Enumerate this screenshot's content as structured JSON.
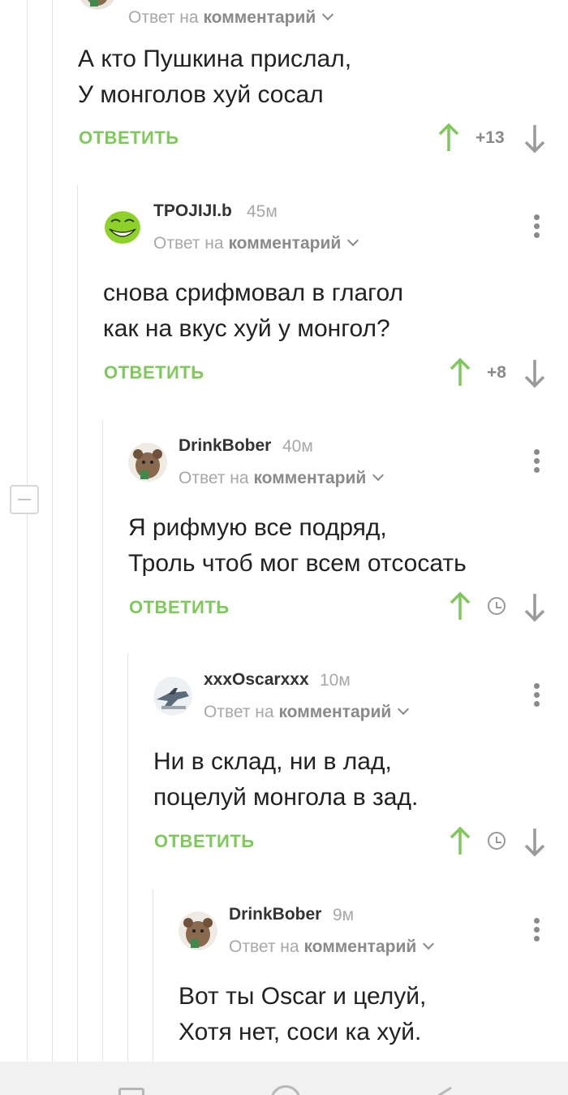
{
  "thread": {
    "comments": [
      {
        "username": "",
        "time": "",
        "reply_prefix": "Ответ на",
        "reply_target": "комментарий",
        "lines": [
          "А кто Пушкина прислал,",
          "У монголов хуй сосал"
        ],
        "reply_label": "ОТВЕТИТЬ",
        "score": "+13",
        "avatar": "beaver"
      },
      {
        "username": "TPOJIJI.b",
        "time": "45м",
        "reply_prefix": "Ответ на",
        "reply_target": "комментарий",
        "lines": [
          "снова срифмовал в глагол",
          "как на вкус хуй у монгол?"
        ],
        "reply_label": "ОТВЕТИТЬ",
        "score": "+8",
        "avatar": "trollface"
      },
      {
        "username": "DrinkBober",
        "time": "40м",
        "reply_prefix": "Ответ на",
        "reply_target": "комментарий",
        "lines": [
          "Я рифмую все подряд,",
          "Троль чтоб мог всем отсосать"
        ],
        "reply_label": "ОТВЕТИТЬ",
        "score": "",
        "avatar": "beaver"
      },
      {
        "username": "xxxOscarxxx",
        "time": "10м",
        "reply_prefix": "Ответ на",
        "reply_target": "комментарий",
        "lines": [
          "Ни в склад, ни в лад,",
          "поцелуй монгола в зад."
        ],
        "reply_label": "ОТВЕТИТЬ",
        "score": "",
        "avatar": "jet"
      },
      {
        "username": "DrinkBober",
        "time": "9м",
        "reply_prefix": "Ответ на",
        "reply_target": "комментарий",
        "lines": [
          "Вот ты Oscar и целуй,",
          "Хотя нет, соси ка хуй."
        ],
        "reply_label": "",
        "score": "",
        "avatar": "beaver"
      }
    ]
  },
  "icons": {
    "upvote": "arrow-up-icon",
    "downvote": "arrow-down-icon",
    "pending": "clock-icon",
    "menu": "more-vertical-icon",
    "collapse": "minus-box-icon"
  },
  "colors": {
    "accent": "#7ec85c",
    "muted": "#a8a8a8",
    "text": "#222222"
  }
}
